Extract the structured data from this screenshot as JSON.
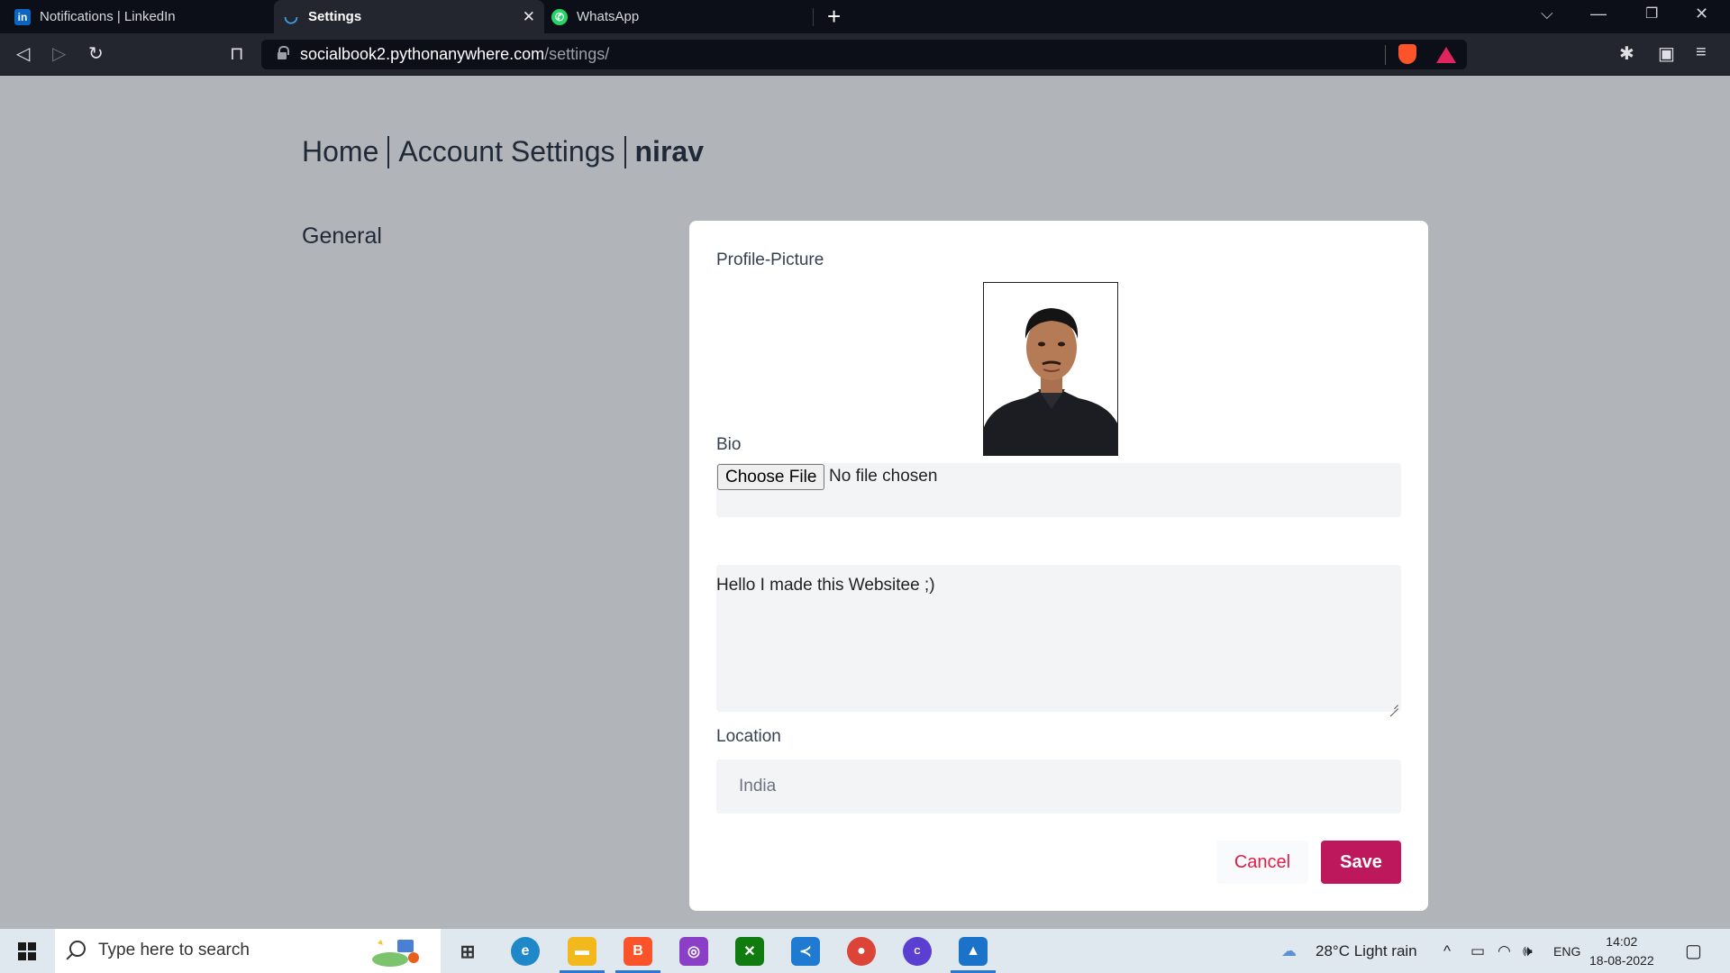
{
  "browser": {
    "tabs": [
      {
        "title": "Notifications | LinkedIn"
      },
      {
        "title": "Settings"
      },
      {
        "title": "WhatsApp"
      }
    ],
    "url": {
      "host": "socialbook2.pythonanywhere.com",
      "path": "/settings/"
    }
  },
  "page": {
    "breadcrumb": {
      "home": "Home",
      "section": "Account Settings",
      "user": "nirav"
    },
    "sidebar": {
      "general": "General"
    },
    "form": {
      "profile_picture_label": "Profile-Picture",
      "choose_file_label": "Choose File",
      "no_file_text": "No file chosen",
      "bio_label": "Bio",
      "bio_value": "Hello I made this Websitee ;)",
      "location_label": "Location",
      "location_value": "India",
      "cancel_label": "Cancel",
      "save_label": "Save"
    }
  },
  "taskbar": {
    "search_placeholder": "Type here to search",
    "weather": "28°C  Light rain",
    "language": "ENG",
    "time": "14:02",
    "date": "18-08-2022"
  },
  "colors": {
    "page_bg": "#b1b4b9",
    "save_button": "#be185d",
    "cancel_text": "#e11d48",
    "input_bg": "#f3f4f6"
  }
}
